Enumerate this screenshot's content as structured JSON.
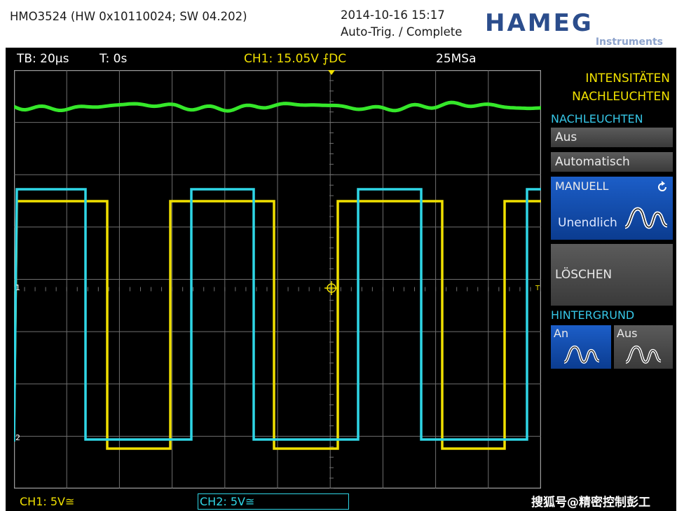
{
  "header": {
    "model": "HMO3524 (HW 0x10110024; SW 04.202)",
    "datetime": "2014-10-16 15:17",
    "trigger_state": "Auto-Trig. / Complete",
    "brand": "HAMEG",
    "brand_sub": "Instruments"
  },
  "status": {
    "timebase": "TB: 20µs",
    "trigger_time": "T: 0s",
    "ch1_trigger": "CH1: 15.05V ⨍DC",
    "sample_rate": "25MSa"
  },
  "menu": {
    "title1": "INTENSITÄTEN",
    "title2": "NACHLEUCHTEN",
    "section_label": "NACHLEUCHTEN",
    "items": [
      "Aus",
      "Automatisch"
    ],
    "manual_label": "MANUELL",
    "manual_value": "Unendlich",
    "clear_label": "LÖSCHEN",
    "background_label": "HINTERGRUND",
    "bg_on": "An",
    "bg_off": "Aus"
  },
  "channels": {
    "ch1_scale": "CH1: 5V≅",
    "ch2_scale": "CH2: 5V≅",
    "ch1_marker": "1",
    "ch2_marker": "2",
    "trigger_marker": "T"
  },
  "colors": {
    "ch1": "#f0e000",
    "ch2": "#2fd6e6",
    "ch3": "#35e82a",
    "accent": "#1c5ec8",
    "grid": "#6f6f6f"
  },
  "watermark": "搜狐号@精密控制彭工"
}
